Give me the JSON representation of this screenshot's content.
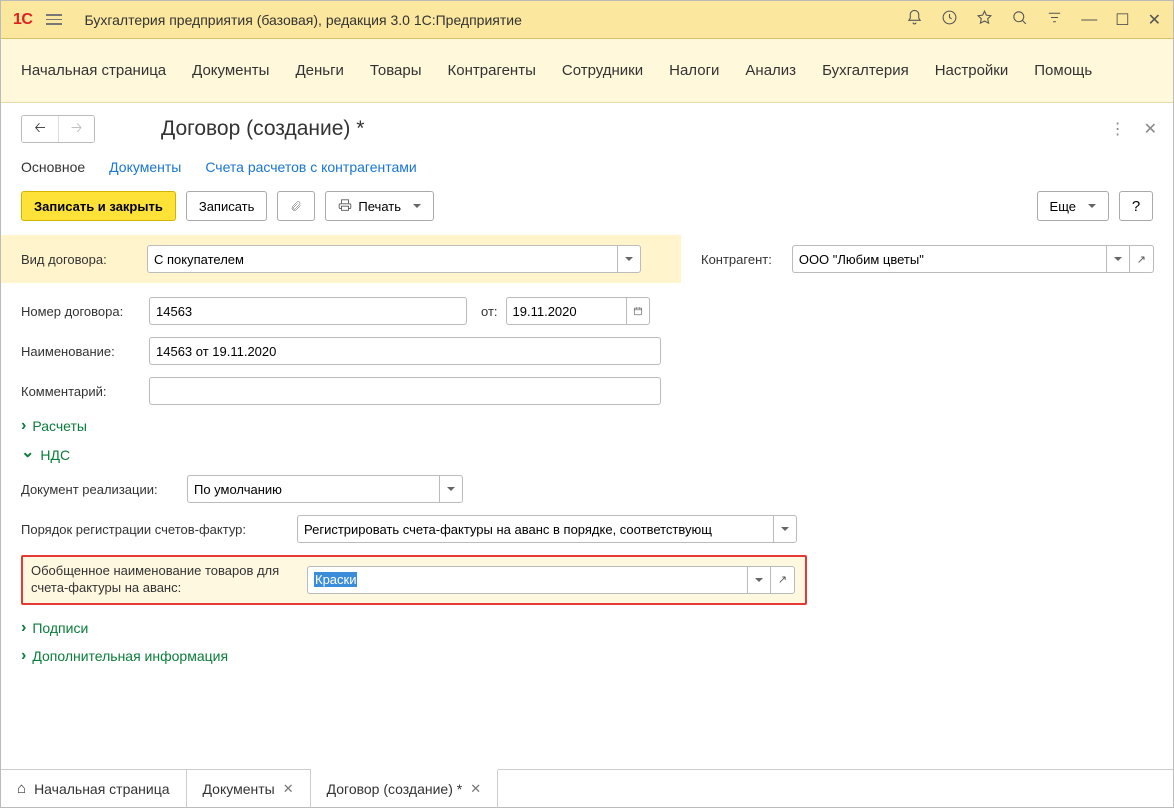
{
  "titlebar": {
    "logo": "1С",
    "title": "Бухгалтерия предприятия (базовая), редакция 3.0 1С:Предприятие"
  },
  "menu": [
    "Начальная страница",
    "Документы",
    "Деньги",
    "Товары",
    "Контрагенты",
    "Сотрудники",
    "Налоги",
    "Анализ",
    "Бухгалтерия",
    "Настройки",
    "Помощь"
  ],
  "form": {
    "title": "Договор (создание) *",
    "tabs": {
      "main": "Основное",
      "docs": "Документы",
      "accounts": "Счета расчетов с контрагентами"
    },
    "buttons": {
      "saveclose": "Записать и закрыть",
      "save": "Записать",
      "print": "Печать",
      "more": "Еще",
      "help": "?"
    },
    "fields": {
      "contract_type_label": "Вид договора:",
      "contract_type_value": "С покупателем",
      "counterparty_label": "Контрагент:",
      "counterparty_value": "ООО \"Любим цветы\"",
      "number_label": "Номер договора:",
      "number_value": "14563",
      "date_label": "от:",
      "date_value": "19.11.2020",
      "name_label": "Наименование:",
      "name_value": "14563 от 19.11.2020",
      "comment_label": "Комментарий:",
      "comment_value": "",
      "calc_group": "Расчеты",
      "nds_group": "НДС",
      "real_doc_label": "Документ реализации:",
      "real_doc_value": "По умолчанию",
      "invoice_order_label": "Порядок регистрации счетов-фактур:",
      "invoice_order_value": "Регистрировать счета-фактуры на аванс в порядке, соответствующ",
      "generic_name_label": "Обобщенное наименование товаров для счета-фактуры на аванс:",
      "generic_name_value": "Краски",
      "signatures_group": "Подписи",
      "addinfo_group": "Дополнительная информация"
    }
  },
  "bottom_tabs": {
    "home": "Начальная страница",
    "docs": "Документы",
    "current": "Договор (создание) *"
  }
}
